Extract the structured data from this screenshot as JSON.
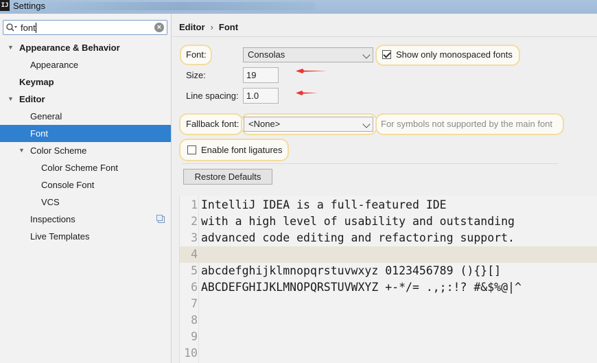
{
  "window": {
    "title": "Settings",
    "app_icon": "IJ"
  },
  "search": {
    "value": "font"
  },
  "tree": [
    {
      "label": "Appearance & Behavior",
      "expanded": true
    },
    {
      "label": "Appearance"
    },
    {
      "label": "Keymap"
    },
    {
      "label": "Editor",
      "expanded": true
    },
    {
      "label": "General"
    },
    {
      "label": "Font",
      "selected": true
    },
    {
      "label": "Color Scheme",
      "expanded": true
    },
    {
      "label": "Color Scheme Font"
    },
    {
      "label": "Console Font"
    },
    {
      "label": "VCS"
    },
    {
      "label": "Inspections"
    },
    {
      "label": "Live Templates"
    }
  ],
  "breadcrumb": {
    "parent": "Editor",
    "separator": "›",
    "current": "Font"
  },
  "form": {
    "font_label": "Font:",
    "font_value": "Consolas",
    "show_mono_label": "Show only monospaced fonts",
    "show_mono_checked": true,
    "size_label": "Size:",
    "size_value": "19",
    "line_spacing_label": "Line spacing:",
    "line_spacing_value": "1.0",
    "fallback_label": "Fallback font:",
    "fallback_value": "<None>",
    "fallback_hint": "For symbols not supported by the main font",
    "ligatures_label": "Enable font ligatures",
    "ligatures_checked": false,
    "restore_label": "Restore Defaults"
  },
  "preview": {
    "lines": [
      {
        "num": "1",
        "text": "IntelliJ IDEA is a full-featured IDE"
      },
      {
        "num": "2",
        "text": "with a high level of usability and outstanding"
      },
      {
        "num": "3",
        "text": "advanced code editing and refactoring support."
      },
      {
        "num": "4",
        "text": "",
        "current": true
      },
      {
        "num": "5",
        "text": "abcdefghijklmnopqrstuvwxyz 0123456789 (){}[]"
      },
      {
        "num": "6",
        "text": "ABCDEFGHIJKLMNOPQRSTUVWXYZ +-*/= .,;:!? #&$%@|^"
      },
      {
        "num": "7",
        "text": ""
      },
      {
        "num": "8",
        "text": ""
      },
      {
        "num": "9",
        "text": ""
      },
      {
        "num": "10",
        "text": ""
      }
    ]
  },
  "colors": {
    "selection": "#2f80cf",
    "highlight_ring": "#f3dca0",
    "annotation_arrow": "#e53935"
  }
}
